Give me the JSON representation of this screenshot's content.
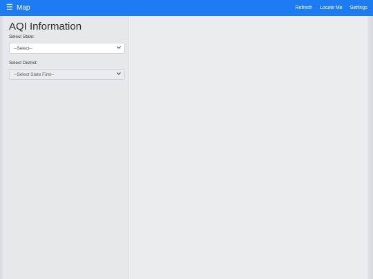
{
  "navbar": {
    "menu_icon": "☰",
    "brand": "Map",
    "links": [
      "Refresh",
      "Locate Me",
      "Settings"
    ]
  },
  "sidebar": {
    "title": "AQI Information",
    "state_label": "Select State:",
    "state_value": "--Select--",
    "district_label": "Select District:",
    "district_value": "--Select State First--"
  },
  "colors": {
    "navbar_bg": "#1e7cf2",
    "page_bg": "#e9ebef"
  },
  "icons": {
    "menu": "hamburger-menu-icon",
    "dropdown": "chevron-down-icon"
  }
}
